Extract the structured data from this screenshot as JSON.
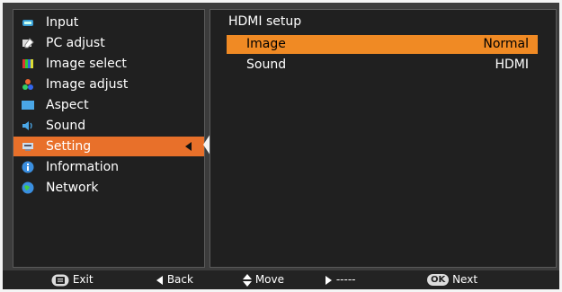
{
  "menu": {
    "items": [
      {
        "label": "Input",
        "icon": "input-icon",
        "color": "#3aa0d8"
      },
      {
        "label": "PC adjust",
        "icon": "pc-adjust-icon",
        "color": "#dddddd"
      },
      {
        "label": "Image select",
        "icon": "image-select-icon",
        "color": "#d33"
      },
      {
        "label": "Image adjust",
        "icon": "image-adjust-icon",
        "color": "#e63"
      },
      {
        "label": "Aspect",
        "icon": "aspect-icon",
        "color": "#4aa6e6"
      },
      {
        "label": "Sound",
        "icon": "sound-icon",
        "color": "#4aa6e6"
      },
      {
        "label": "Setting",
        "icon": "setting-icon",
        "color": "#9ad"
      },
      {
        "label": "Information",
        "icon": "information-icon",
        "color": "#3b8fe0"
      },
      {
        "label": "Network",
        "icon": "network-icon",
        "color": "#3a8fe0"
      }
    ],
    "active_index": 6,
    "accent_color": "#e8702a"
  },
  "panel": {
    "title": "HDMI setup",
    "rows": [
      {
        "label": "Image",
        "value": "Normal",
        "selected": true
      },
      {
        "label": "Sound",
        "value": "HDMI",
        "selected": false
      }
    ],
    "row_highlight_color": "#f08a24"
  },
  "footer": {
    "exit_label": "Exit",
    "back_label": "Back",
    "move_label": "Move",
    "dashes_label": "-----",
    "ok_key_label": "OK",
    "next_label": "Next"
  }
}
